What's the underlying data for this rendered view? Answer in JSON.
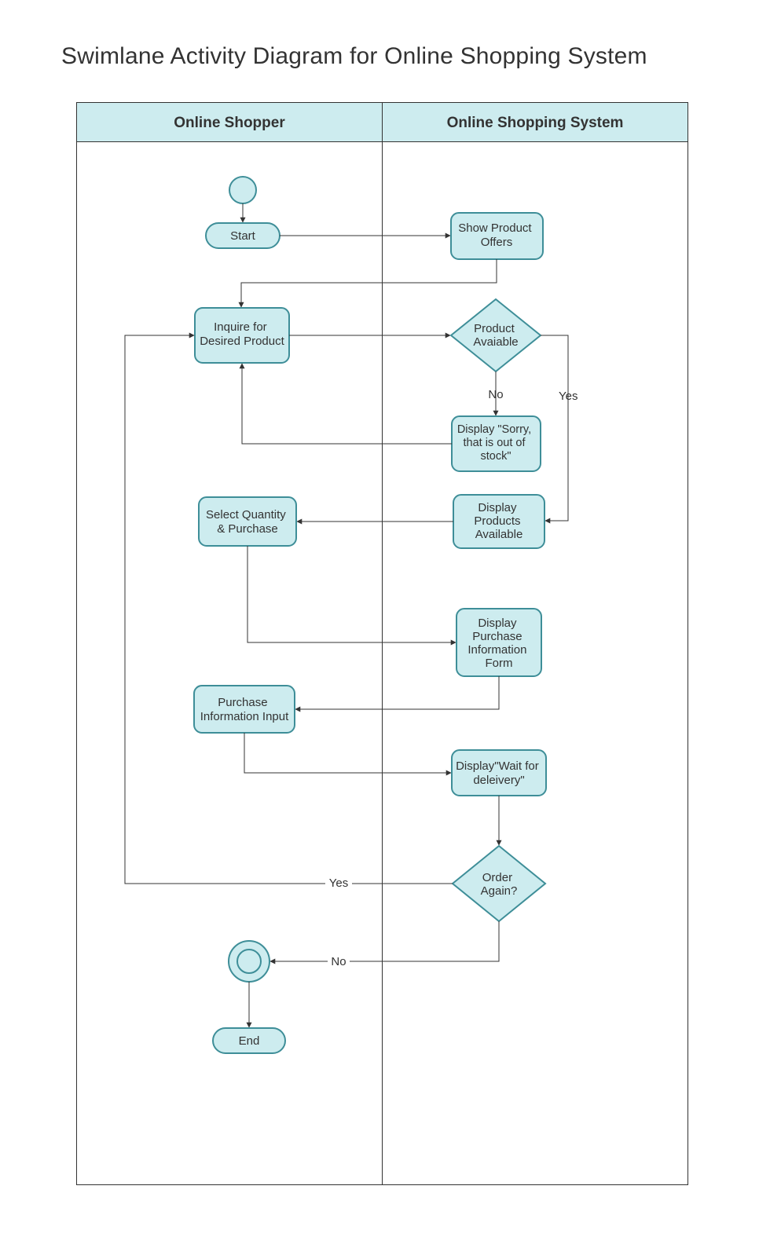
{
  "title": "Swimlane Activity Diagram for Online Shopping System",
  "lanes": {
    "left": "Online Shopper",
    "right": "Online Shopping System"
  },
  "nodes": {
    "start": "Start",
    "showOffers": "Show Product\nOffers",
    "inquire": "Inquire for\nDesired Product",
    "productAvail": "Product\nAvaiable",
    "outOfStock": "Display \"Sorry,\nthat is out of\nstock\"",
    "displayProducts": "Display\nProducts\nAvailable",
    "selectQty": "Select Quantity\n& Purchase",
    "purchaseForm": "Display\nPurchase\nInformation\nForm",
    "purchaseInput": "Purchase\nInformation Input",
    "waitDelivery": "Display\"Wait for\ndeleivery\"",
    "orderAgain": "Order\nAgain?",
    "end": "End"
  },
  "edgeLabels": {
    "no1": "No",
    "yes1": "Yes",
    "yes2": "Yes",
    "no2": "No"
  },
  "colors": {
    "fill": "#cdecef",
    "stroke": "#3e8e98",
    "text": "#333333",
    "line": "#333333"
  }
}
